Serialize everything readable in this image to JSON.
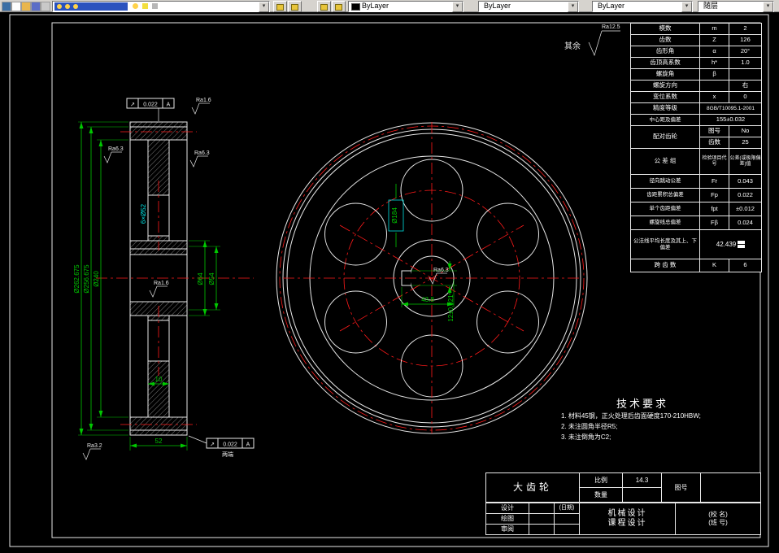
{
  "icons": {
    "chevron_down": "▾"
  },
  "toolbar": {
    "color_value": "ByLayer",
    "linetype_value": "ByLayer",
    "lineweight_value": "ByLayer",
    "plotstyle_value": "随层"
  },
  "general_roughness": {
    "label": "其余",
    "value": "Ra12.5"
  },
  "param_table": {
    "rows": [
      {
        "label": "模数",
        "sym": "m",
        "val": "2"
      },
      {
        "label": "齿数",
        "sym": "Z",
        "val": "126"
      },
      {
        "label": "齿形角",
        "sym": "α",
        "val": "20°"
      },
      {
        "label": "齿顶高系数",
        "sym": "h*",
        "val": "1.0"
      },
      {
        "label": "螺旋角",
        "sym": "β",
        "val": ""
      },
      {
        "label": "螺旋方向",
        "sym": "",
        "val": "右"
      },
      {
        "label": "变位系数",
        "sym": "x",
        "val": "0"
      }
    ],
    "accuracy_label": "精度等级",
    "accuracy_val": "8GB/T10095.1-2001",
    "center_label": "中心距及偏差",
    "center_val": "155±0.032",
    "mate_label": "配对齿轮",
    "mate_rows": [
      {
        "label": "图号",
        "val": "No"
      },
      {
        "label": "齿数",
        "val": "25"
      }
    ],
    "tol_header": {
      "group": "公 差 组",
      "item": "检验项目代号",
      "value": "公差(或极限偏差)值"
    },
    "tol_rows": [
      {
        "label": "径向跳动公差",
        "sym": "Fr",
        "val": "0.043"
      },
      {
        "label": "齿距累积总偏差",
        "sym": "Fp",
        "val": "0.022"
      },
      {
        "label": "单个齿距偏差",
        "sym": "fpt",
        "val": "±0.012"
      },
      {
        "label": "螺旋线总偏差",
        "sym": "Fβ",
        "val": "0.024"
      }
    ],
    "wn_label": "公法线平均长度及其上、下偏差",
    "wn_val": "42.439",
    "span_label": "跨 齿 数",
    "span_sym": "K",
    "span_val": "6"
  },
  "tech_req": {
    "title": "技术要求",
    "items": [
      "1. 材料45钢，正火处理后齿面硬度170-210HBW;",
      "2. 未注圆角半径R5;",
      "3. 未注倒角为C2;"
    ]
  },
  "title_block": {
    "part_name": "大齿轮",
    "scale_label": "比例",
    "scale_val": "14.3",
    "qty_label": "数量",
    "qty_val": "",
    "drawno_label": "图号",
    "drawno_val": "",
    "design_label": "设计",
    "date_label": "(日期)",
    "draw_label": "绘图",
    "review_label": "审阅",
    "course_line1": "机械设计",
    "course_line2": "课程设计",
    "school_line1": "(校 名)",
    "school_line2": "(班 号)"
  },
  "dims": {
    "left": {
      "d_tip": "Ø262.675",
      "d_pitch": "Ø256.675",
      "d_root": "Ø240",
      "d_hub": "Ø64",
      "d_step": "Ø54",
      "holes": "6×Ø52",
      "width": "52",
      "web": "10",
      "gdt_sym": "↗",
      "gdt_tol": "0.022",
      "gdt_datum": "A",
      "both_ends": "两端",
      "ra_top": "Ra1.6",
      "ra_left": "Ra6.3",
      "ra_right": "Ra6.3",
      "ra_bore": "Ra1.6",
      "ra_bottom": "Ra3.2"
    },
    "front": {
      "bolt_circle": "Ø184",
      "keyway_width": "12±0.021",
      "keyway_depth": "43.8",
      "ra_keyway": "Ra6.3"
    }
  }
}
